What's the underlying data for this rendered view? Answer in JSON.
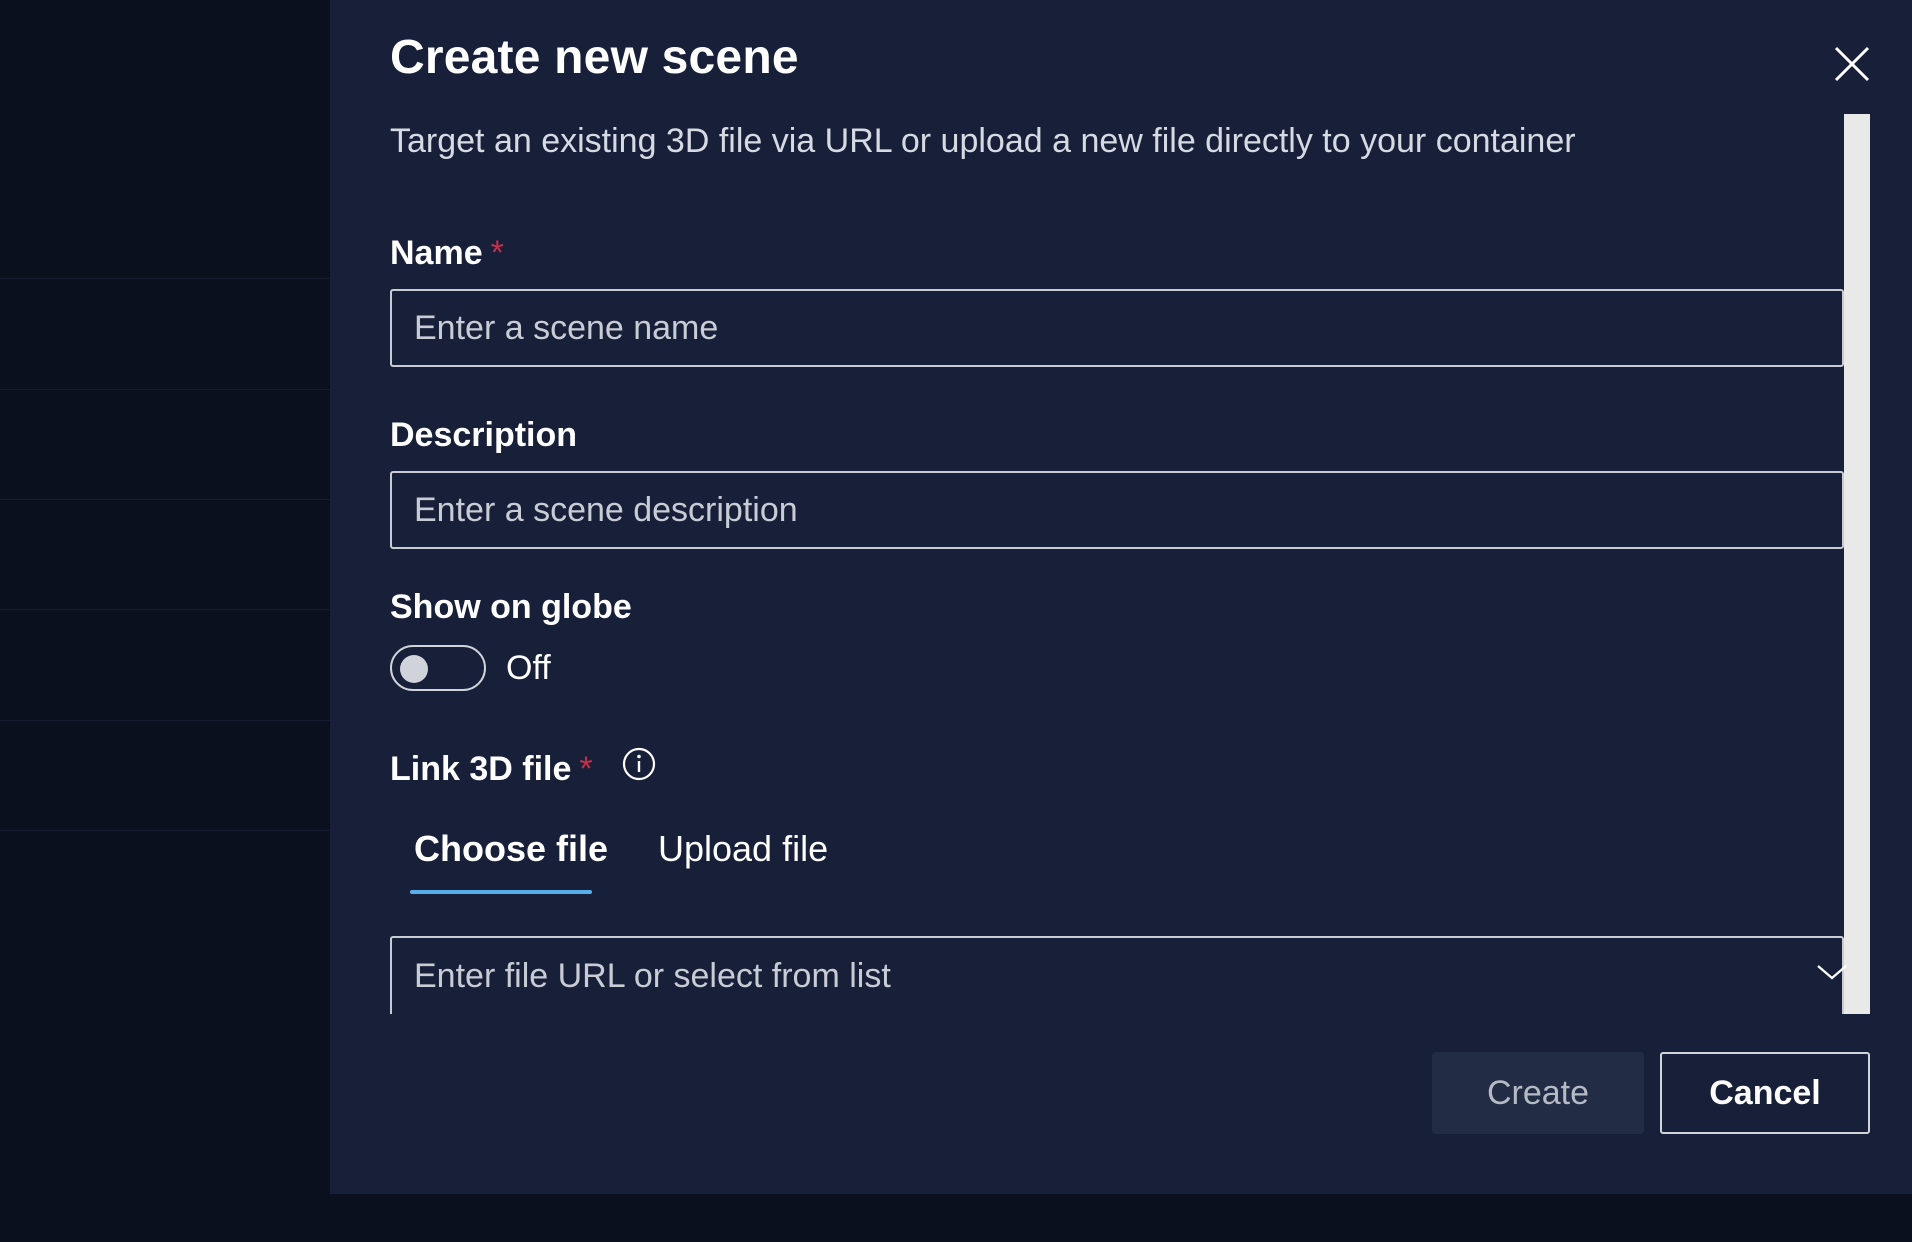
{
  "dialog": {
    "title": "Create new scene",
    "subtitle": "Target an existing 3D file via URL or upload a new file directly to your container"
  },
  "fields": {
    "name": {
      "label": "Name",
      "required_mark": "*",
      "placeholder": "Enter a scene name"
    },
    "description": {
      "label": "Description",
      "placeholder": "Enter a scene description"
    },
    "globe": {
      "label": "Show on globe",
      "state_text": "Off",
      "on": false
    },
    "link_file": {
      "label": "Link 3D file",
      "required_mark": "*",
      "tabs": [
        {
          "label": "Choose file",
          "active": true
        },
        {
          "label": "Upload file",
          "active": false
        }
      ],
      "placeholder": "Enter file URL or select from list"
    }
  },
  "actions": {
    "create_label": "Create",
    "cancel_label": "Cancel"
  },
  "icons": {
    "close": "close-icon",
    "info": "info-icon",
    "chevron": "chevron-down-icon"
  },
  "colors": {
    "dialog_bg": "#182039",
    "backdrop": "#0a101e",
    "accent": "#58aee8",
    "required": "#c4314b"
  }
}
